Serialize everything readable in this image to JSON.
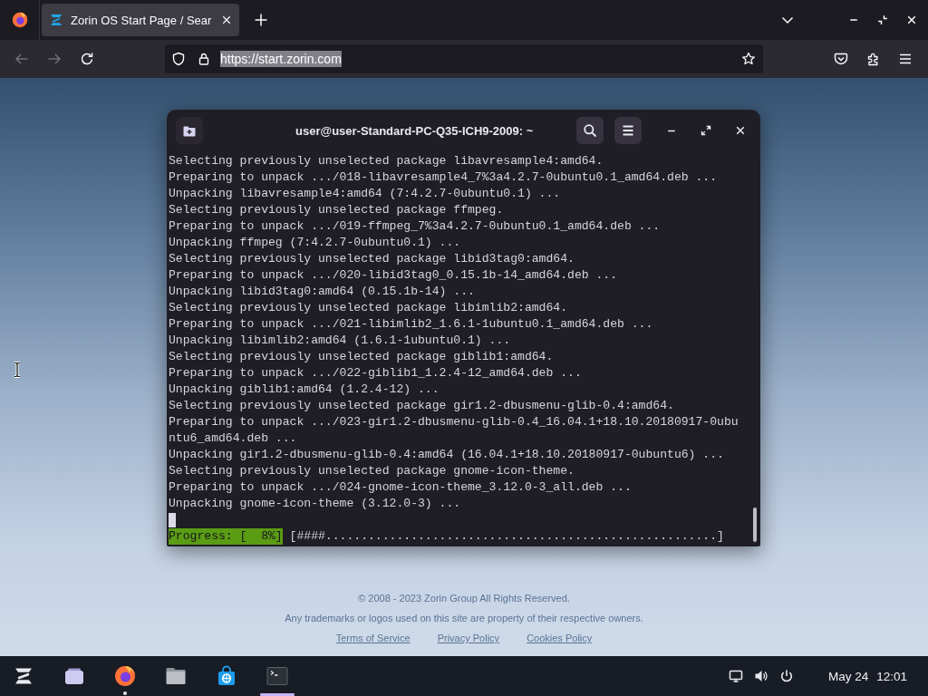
{
  "browser": {
    "tabs": [
      {
        "title": "Zorin OS Start Page / Sear",
        "selected": true
      }
    ],
    "nav_buttons": [
      {
        "kind": "back",
        "disabled": true
      },
      {
        "kind": "forward",
        "disabled": true
      },
      {
        "kind": "reload",
        "disabled": false
      }
    ],
    "url": {
      "text": "https://start.zorin.com",
      "selected": true
    }
  },
  "terminal": {
    "title": "user@user-Standard-PC-Q35-ICH9-2009: ~",
    "lines": [
      "Selecting previously unselected package libavresample4:amd64.",
      "Preparing to unpack .../018-libavresample4_7%3a4.2.7-0ubuntu0.1_amd64.deb ...",
      "Unpacking libavresample4:amd64 (7:4.2.7-0ubuntu0.1) ...",
      "Selecting previously unselected package ffmpeg.",
      "Preparing to unpack .../019-ffmpeg_7%3a4.2.7-0ubuntu0.1_amd64.deb ...",
      "Unpacking ffmpeg (7:4.2.7-0ubuntu0.1) ...",
      "Selecting previously unselected package libid3tag0:amd64.",
      "Preparing to unpack .../020-libid3tag0_0.15.1b-14_amd64.deb ...",
      "Unpacking libid3tag0:amd64 (0.15.1b-14) ...",
      "Selecting previously unselected package libimlib2:amd64.",
      "Preparing to unpack .../021-libimlib2_1.6.1-1ubuntu0.1_amd64.deb ...",
      "Unpacking libimlib2:amd64 (1.6.1-1ubuntu0.1) ...",
      "Selecting previously unselected package giblib1:amd64.",
      "Preparing to unpack .../022-giblib1_1.2.4-12_amd64.deb ...",
      "Unpacking giblib1:amd64 (1.2.4-12) ...",
      "Selecting previously unselected package gir1.2-dbusmenu-glib-0.4:amd64.",
      "Preparing to unpack .../023-gir1.2-dbusmenu-glib-0.4_16.04.1+18.10.20180917-0ubu",
      "ntu6_amd64.deb ...",
      "Unpacking gir1.2-dbusmenu-glib-0.4:amd64 (16.04.1+18.10.20180917-0ubuntu6) ...",
      "Selecting previously unselected package gnome-icon-theme.",
      "Preparing to unpack .../024-gnome-icon-theme_3.12.0-3_all.deb ...",
      "Unpacking gnome-icon-theme (3.12.0-3) ..."
    ],
    "progress": {
      "label": "Progress: [  8%]",
      "bar": "[####.......................................................]"
    }
  },
  "footer": {
    "copyright": "© 2008 - 2023 Zorin Group All Rights Reserved.",
    "notice": "Any trademarks or logos used on this site are property of their respective owners.",
    "links": [
      "Terms of Service",
      "Privacy Policy",
      "Cookies Policy"
    ]
  },
  "taskbar": {
    "apps": [
      {
        "kind": "menu",
        "running": false,
        "selected": false
      },
      {
        "kind": "overview",
        "running": false,
        "selected": false
      },
      {
        "kind": "browser",
        "running": true,
        "selected": false
      },
      {
        "kind": "files",
        "running": false,
        "selected": false
      },
      {
        "kind": "store",
        "running": false,
        "selected": false
      },
      {
        "kind": "terminal",
        "running": false,
        "selected": true
      }
    ],
    "date": "May 24",
    "time": "12:01"
  }
}
